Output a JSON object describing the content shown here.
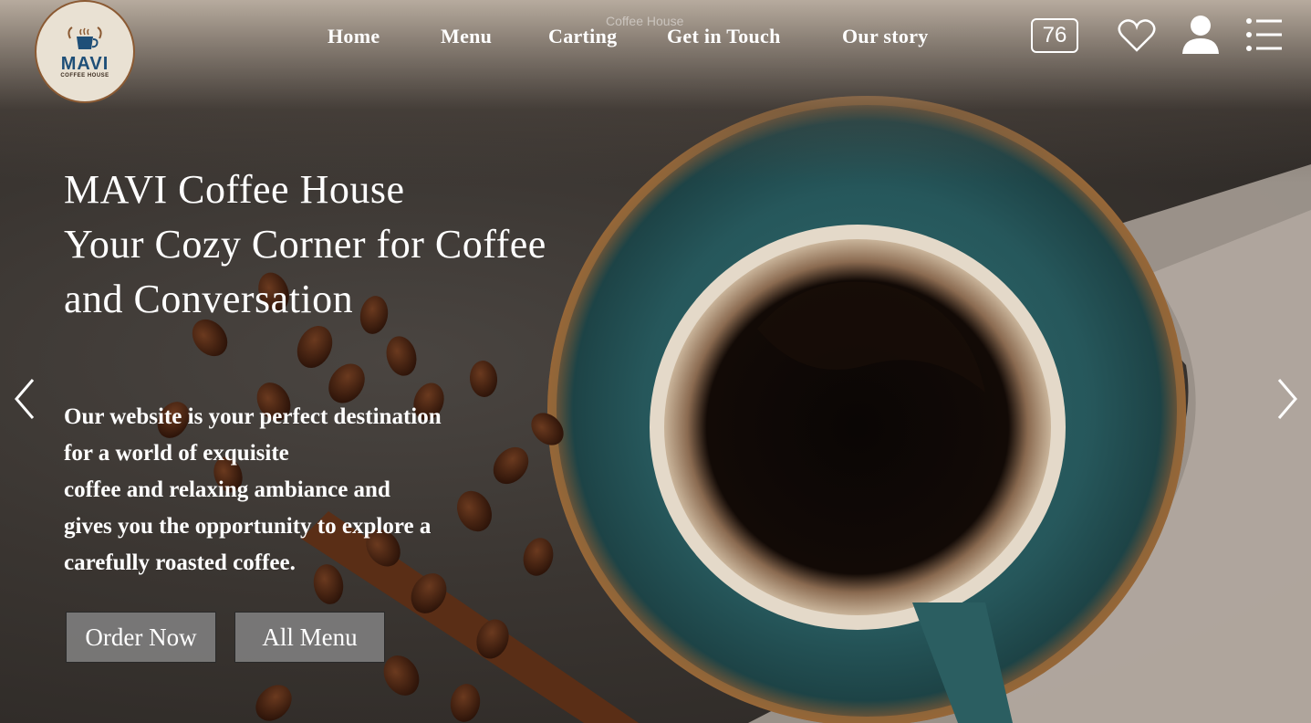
{
  "brand": {
    "name": "MAVI",
    "subtitle": "COFFEE HOUSE",
    "tab_ghost": "Coffee House"
  },
  "nav": {
    "items": [
      "Home",
      "Menu",
      "Carting",
      "Get in Touch",
      "Our story"
    ]
  },
  "header": {
    "cart_count": "76",
    "icons": [
      "heart-icon",
      "user-icon",
      "menu-list-icon"
    ]
  },
  "hero": {
    "title_lines": [
      "MAVI Coffee House",
      "Your Cozy Corner for Coffee",
      "and Conversation"
    ],
    "description_lines": [
      "Our website is your perfect destination",
      "for a world of exquisite",
      "coffee and relaxing ambiance and",
      "gives you the opportunity to explore a",
      "carefully roasted coffee."
    ],
    "buttons": {
      "order_now": "Order Now",
      "all_menu": "All Menu"
    }
  },
  "carousel": {
    "prev_icon": "chevron-left-icon",
    "next_icon": "chevron-right-icon"
  },
  "colors": {
    "accent_teal": "#1f5a5e",
    "text": "#ffffff",
    "button_bg": "#828282"
  }
}
